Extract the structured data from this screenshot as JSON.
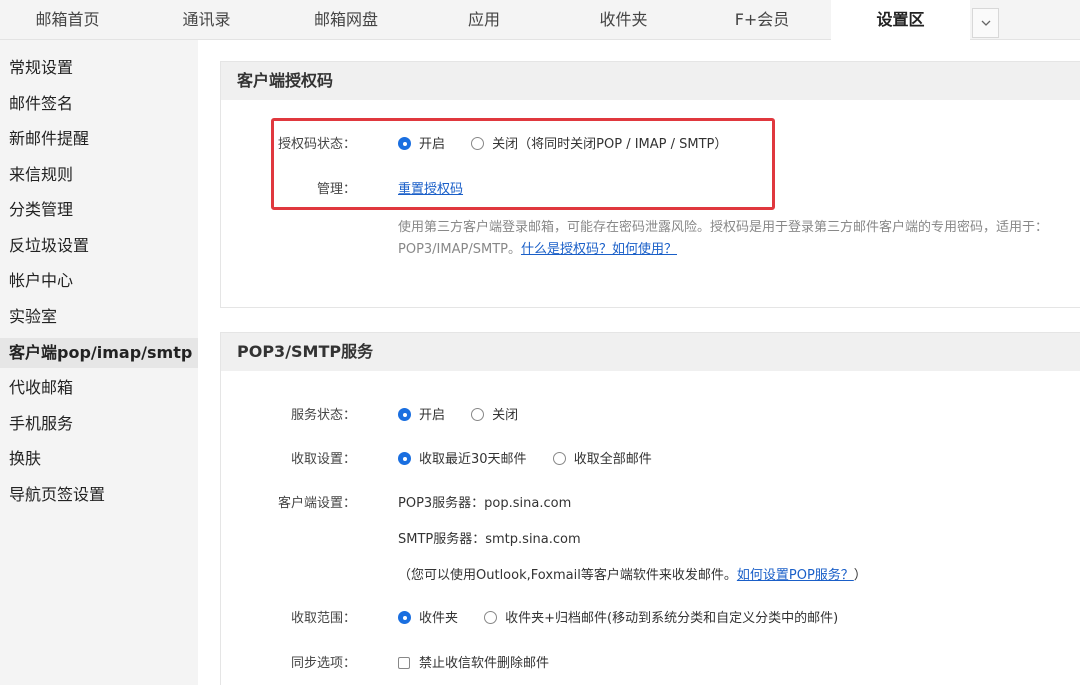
{
  "tabs": [
    {
      "label": "邮箱首页"
    },
    {
      "label": "通讯录"
    },
    {
      "label": "邮箱网盘"
    },
    {
      "label": "应用"
    },
    {
      "label": "收件夹"
    },
    {
      "label": "F+会员"
    },
    {
      "label": "设置区"
    }
  ],
  "tab_dropdown_icon": "chevron-down",
  "sidebar": {
    "items": [
      {
        "label": "常规设置"
      },
      {
        "label": "邮件签名"
      },
      {
        "label": "新邮件提醒"
      },
      {
        "label": "来信规则"
      },
      {
        "label": "分类管理"
      },
      {
        "label": "反垃圾设置"
      },
      {
        "label": "帐户中心"
      },
      {
        "label": "实验室"
      },
      {
        "label": "客户端pop/imap/smtp"
      },
      {
        "label": "代收邮箱"
      },
      {
        "label": "手机服务"
      },
      {
        "label": "换肤"
      },
      {
        "label": "导航页签设置"
      }
    ]
  },
  "auth_panel": {
    "title": "客户端授权码",
    "status_label": "授权码状态：",
    "status_on": "开启",
    "status_off": "关闭（将同时关闭POP / IMAP / SMTP）",
    "manage_label": "管理：",
    "reset_link": "重置授权码",
    "note_text": "使用第三方客户端登录邮箱，可能存在密码泄露风险。授权码是用于登录第三方邮件客户端的专用密码，适用于：POP3/IMAP/SMTP。",
    "note_link": "什么是授权码？如何使用？"
  },
  "pop_panel": {
    "title": "POP3/SMTP服务",
    "service_label": "服务状态：",
    "service_on": "开启",
    "service_off": "关闭",
    "fetch_label": "收取设置：",
    "fetch_recent": "收取最近30天邮件",
    "fetch_all": "收取全部邮件",
    "client_label": "客户端设置：",
    "pop3_server": "POP3服务器：pop.sina.com",
    "smtp_server": "SMTP服务器：smtp.sina.com",
    "client_tip": "（您可以使用Outlook,Foxmail等客户端软件来收发邮件。",
    "client_tip_link": "如何设置POP服务？",
    "client_tip_end": "）",
    "range_label": "收取范围：",
    "range_inbox": "收件夹",
    "range_archive": "收件夹+归档邮件(移动到系统分类和自定义分类中的邮件)",
    "sync_label": "同步选项：",
    "sync_option": "禁止收信软件删除邮件"
  },
  "colors": {
    "accent": "#1a6fe0",
    "highlight_border": "#e0383e"
  }
}
